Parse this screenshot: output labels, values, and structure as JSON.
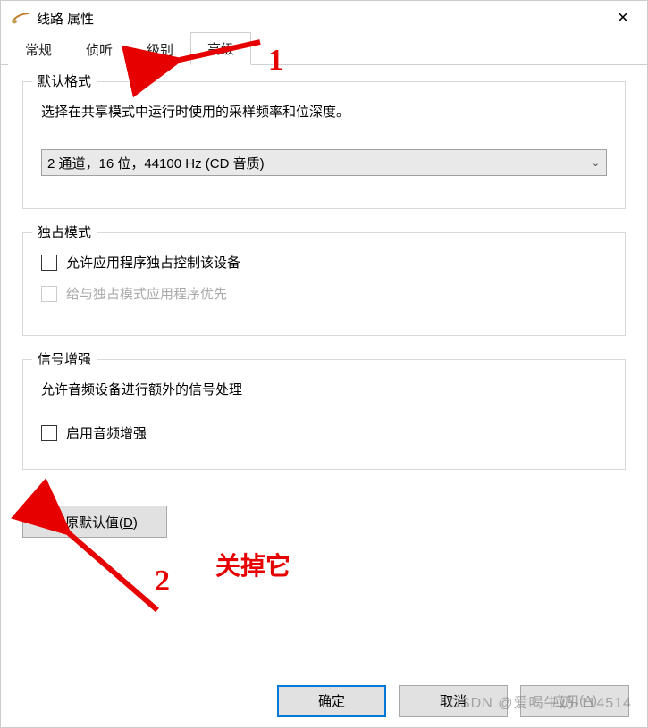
{
  "window": {
    "title": "线路 属性"
  },
  "tabs": [
    {
      "label": "常规"
    },
    {
      "label": "侦听"
    },
    {
      "label": "级别"
    },
    {
      "label": "高级"
    }
  ],
  "default_format": {
    "title": "默认格式",
    "desc": "选择在共享模式中运行时使用的采样频率和位深度。",
    "dropdown_value": "2 通道，16 位，44100 Hz (CD 音质)"
  },
  "exclusive": {
    "title": "独占模式",
    "chk1_label": "允许应用程序独占控制该设备",
    "chk2_label": "给与独占模式应用程序优先"
  },
  "signal": {
    "title": "信号增强",
    "desc": "允许音频设备进行额外的信号处理",
    "chk_label": "启用音频增强"
  },
  "buttons": {
    "restore": "还原默认值",
    "restore_key": "D",
    "ok": "确定",
    "cancel": "取消",
    "apply": "应用",
    "apply_key": "A"
  },
  "annotations": {
    "num1": "1",
    "num2": "2",
    "text": "关掉它"
  },
  "watermark": "CSDN @爱喝牛奶-114514"
}
